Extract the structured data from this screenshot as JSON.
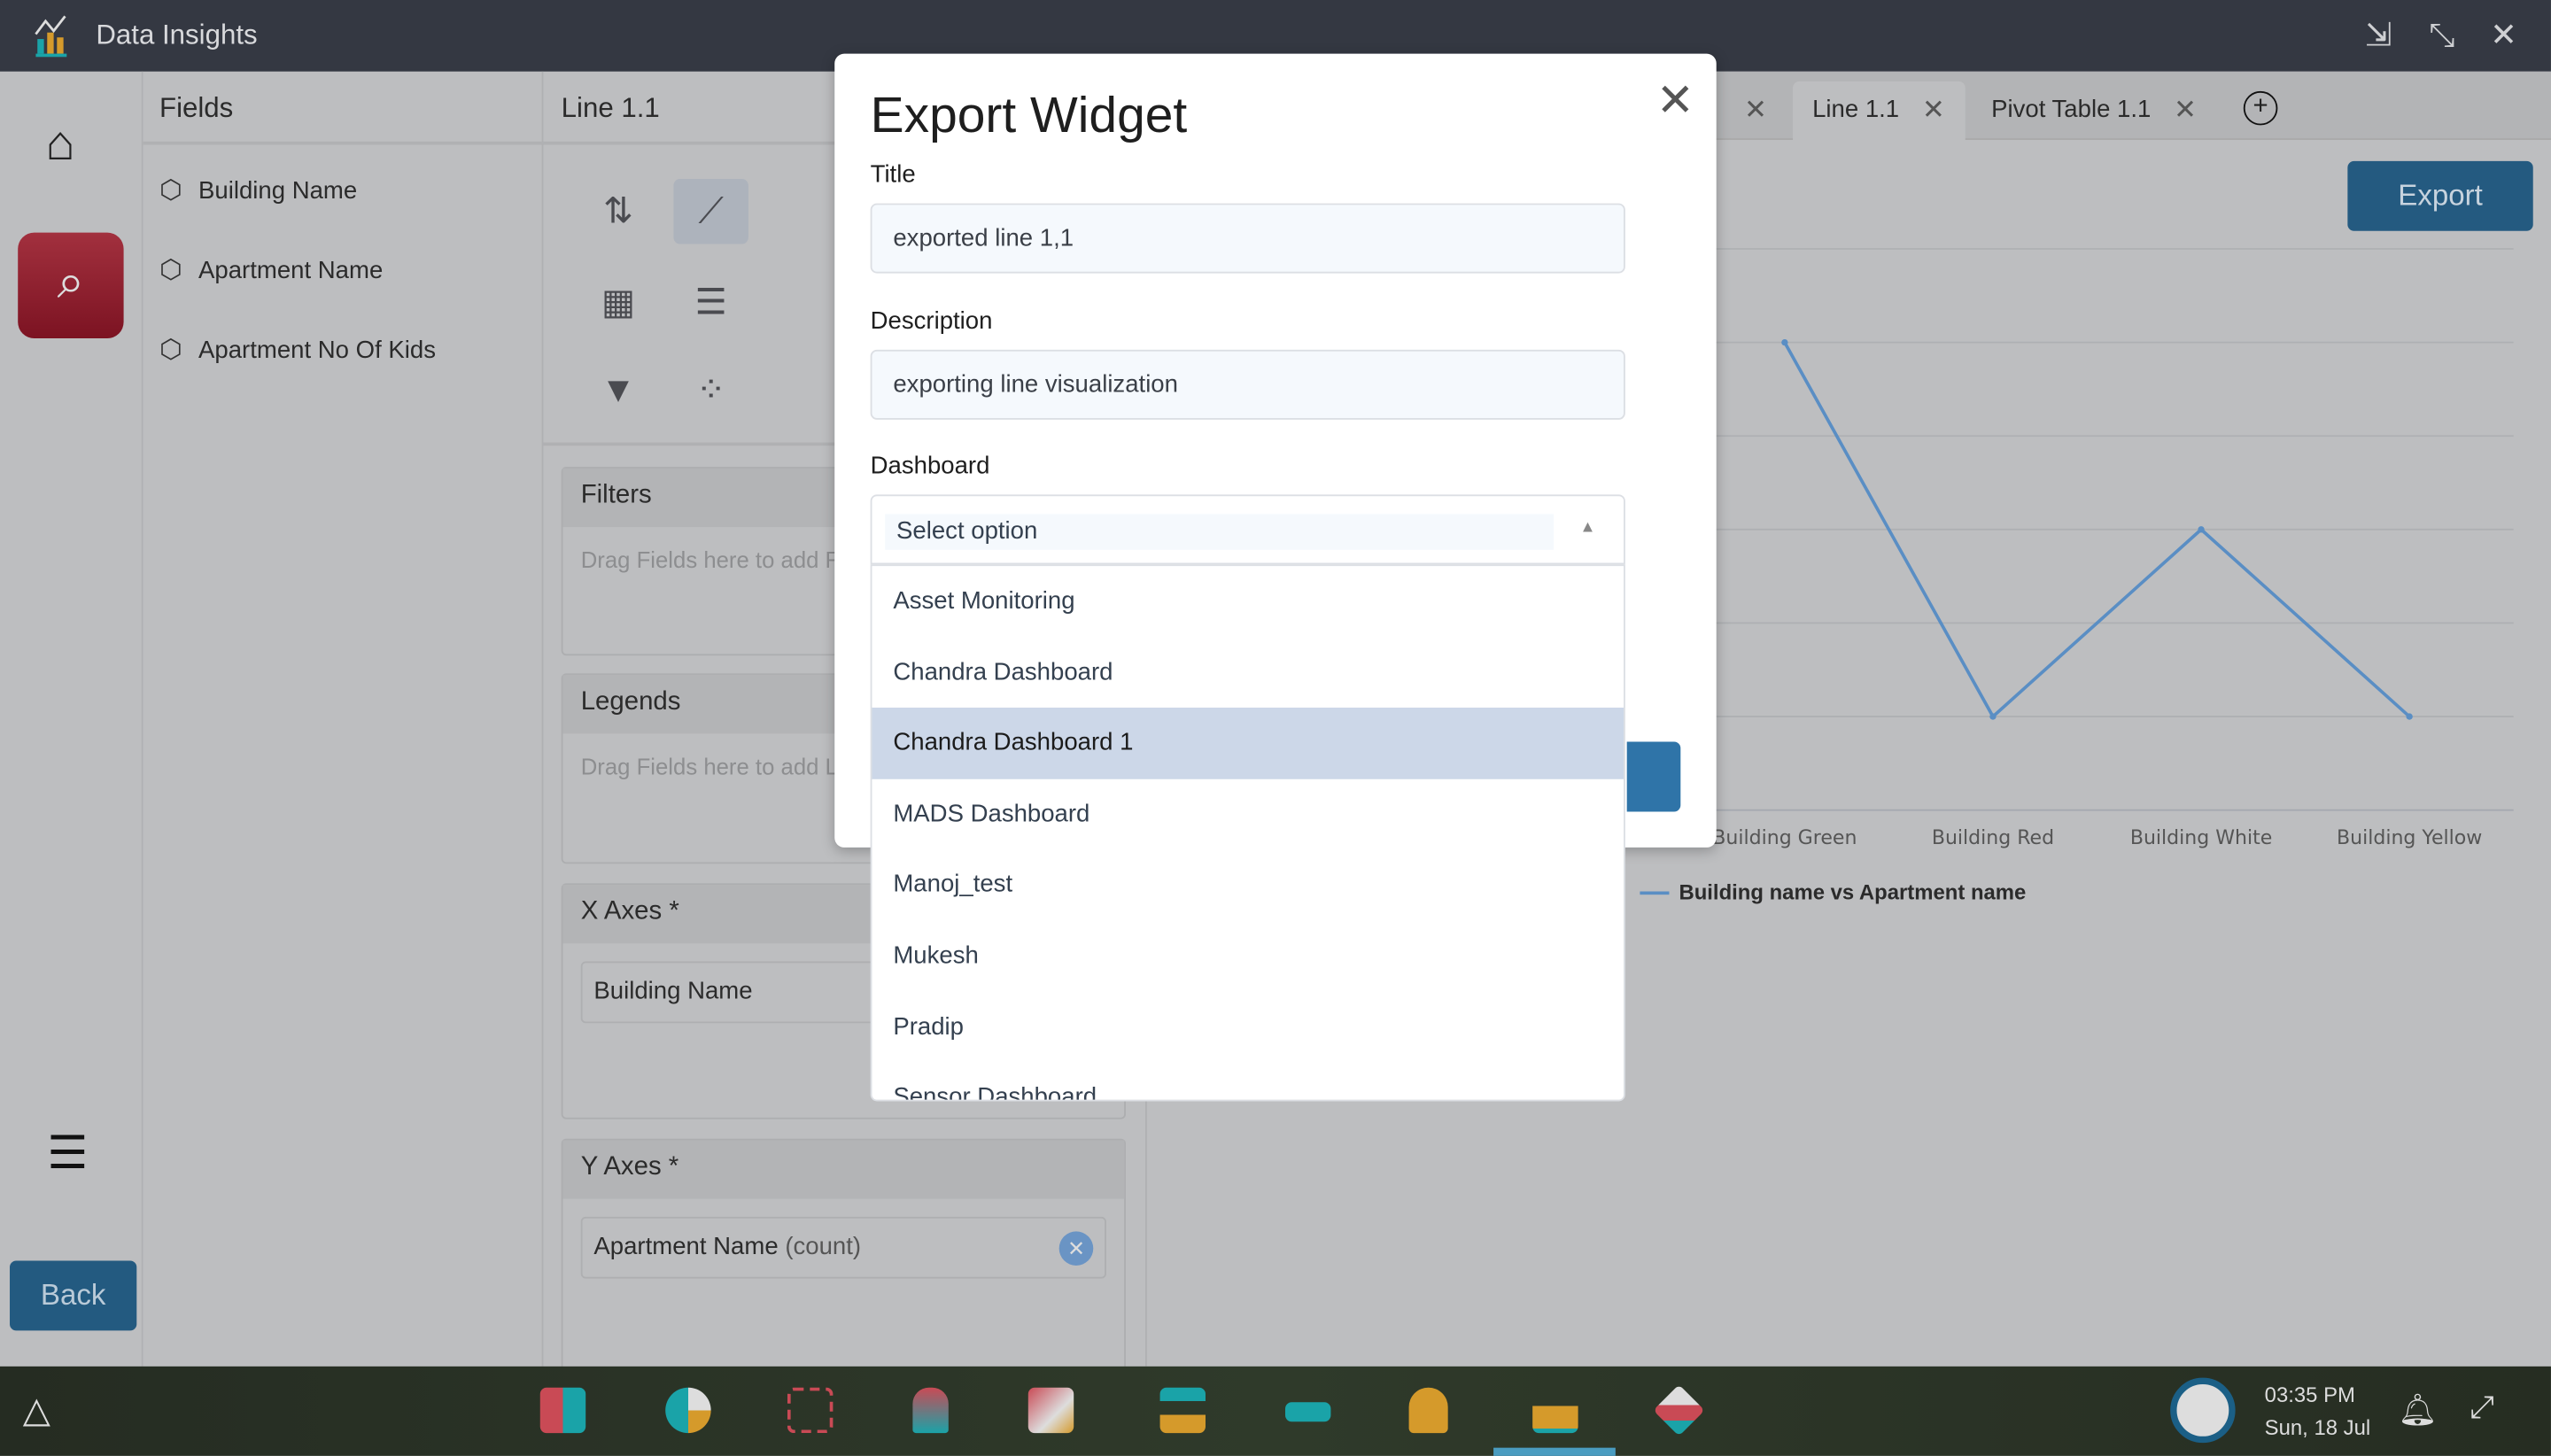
{
  "app": {
    "title": "Data Insights"
  },
  "window_controls": [
    "minimize-window-icon",
    "exit-fullscreen-icon",
    "close-icon"
  ],
  "rail": {
    "back_label": "Back"
  },
  "fields_panel": {
    "title": "Fields",
    "items": [
      "Building Name",
      "Apartment Name",
      "Apartment No Of Kids"
    ]
  },
  "widget_panel": {
    "title": "Line 1.1",
    "filters": {
      "title": "Filters",
      "hint": "Drag Fields here to add Filters"
    },
    "legends": {
      "title": "Legends",
      "hint": "Drag Fields here to add Legends"
    },
    "x_axes": {
      "title": "X Axes *",
      "value": "Building Name"
    },
    "y_axes": {
      "title": "Y Axes *",
      "value": "Apartment Name",
      "agg": "(count)"
    }
  },
  "tabs": [
    {
      "label": "Line 1.1",
      "active": true
    },
    {
      "label": "Pivot Table 1.1",
      "active": false
    }
  ],
  "export_label": "Export",
  "chart_data": {
    "type": "line",
    "categories": [
      "Building Green",
      "Building Red",
      "Building White",
      "Building Yellow"
    ],
    "series": [
      {
        "name": "Building name vs Apartment name",
        "values": [
          5,
          1,
          3,
          1
        ],
        "color": "#5a8ec4"
      }
    ],
    "ylim": [
      0,
      6
    ],
    "grid": true,
    "legend": "bottom-left"
  },
  "modal": {
    "title": "Export Widget",
    "title_label": "Title",
    "title_value": "exported line 1,1",
    "description_label": "Description",
    "description_value": "exporting line visualization",
    "dashboard_label": "Dashboard",
    "dashboard_placeholder": "Select option",
    "options": [
      "Asset Monitoring",
      "Chandra Dashboard",
      "Chandra Dashboard 1",
      "MADS Dashboard",
      "Manoj_test",
      "Mukesh",
      "Pradip",
      "Sensor Dashboard"
    ],
    "highlighted": "Chandra Dashboard 1"
  },
  "taskbar": {
    "time": "03:35 PM",
    "date": "Sun, 18 Jul"
  }
}
